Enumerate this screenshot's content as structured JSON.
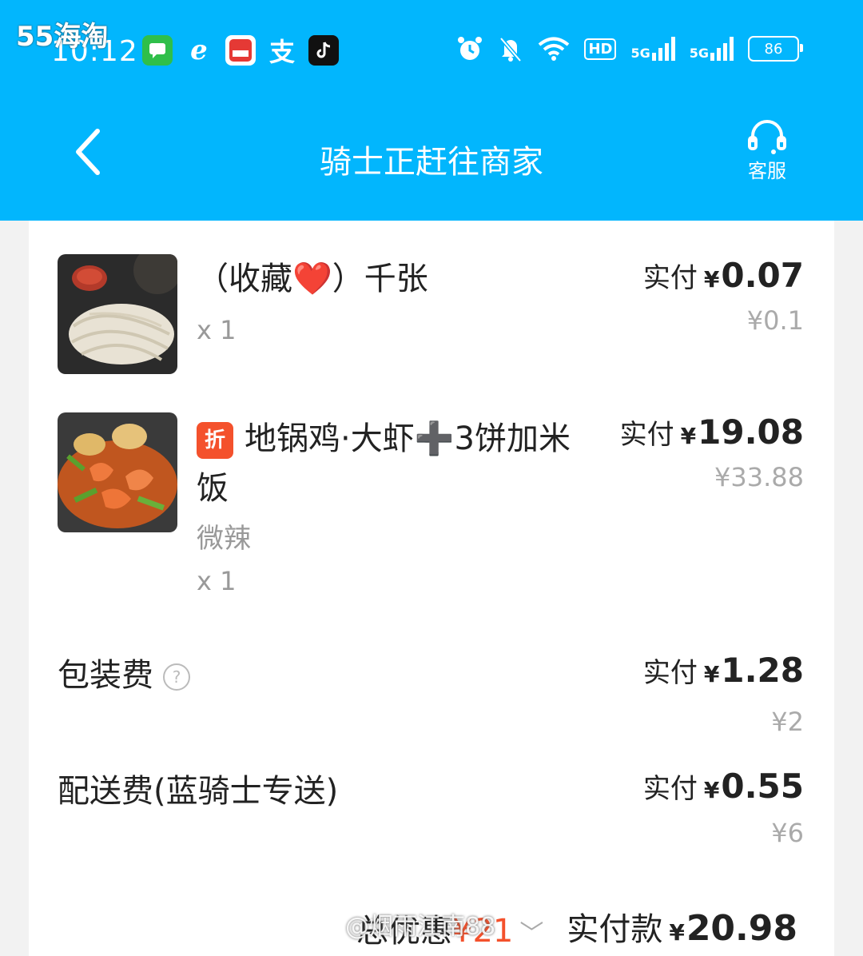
{
  "status_bar": {
    "watermark": "55海淘",
    "time": "10:12",
    "network_1": "5G",
    "network_2": "5G",
    "hd_badge": "HD",
    "battery": "86",
    "app_icons": [
      "messages-icon",
      "ele-icon",
      "cloud-pay-icon",
      "alipay-icon",
      "tiktok-icon"
    ]
  },
  "header": {
    "title": "骑士正赶往商家",
    "service_label": "客服",
    "accent": "#02b6fd"
  },
  "items": [
    {
      "name_main": "（收藏❤️）千张",
      "tag": "",
      "spec": "",
      "qty": "x 1",
      "pay_label": "实付",
      "currency": "¥",
      "pay_value": "0.07",
      "original": "¥0.1"
    },
    {
      "name_main": "地锅鸡·大虾➕3饼加米饭",
      "tag": "折",
      "spec": "微辣",
      "qty": "x 1",
      "pay_label": "实付",
      "currency": "¥",
      "pay_value": "19.08",
      "original": "¥33.88"
    }
  ],
  "fees": [
    {
      "name": "包装费",
      "help": "?",
      "pay_label": "实付",
      "currency": "¥",
      "pay_value": "1.28",
      "original": "¥2"
    },
    {
      "name": "配送费(蓝骑士专送)",
      "pay_label": "实付",
      "currency": "¥",
      "pay_value": "0.55",
      "original": "¥6"
    }
  ],
  "summary": {
    "discount_label": "总优惠",
    "discount_value": "¥21",
    "watermark": "@烟雨江南88",
    "total_label": "实付款",
    "currency": "¥",
    "total_value": "20.98"
  }
}
